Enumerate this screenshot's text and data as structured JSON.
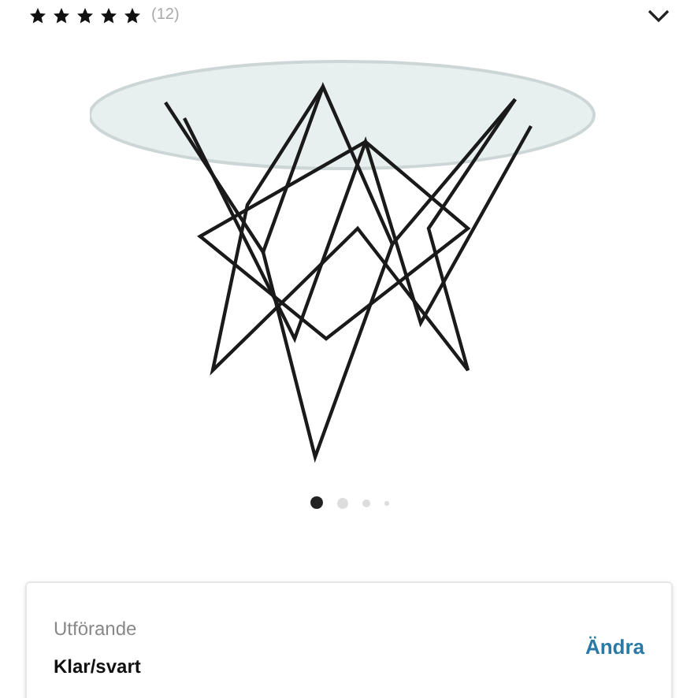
{
  "rating": {
    "stars": 5,
    "count": "(12)"
  },
  "gallery": {
    "dots": [
      {
        "selected": true
      },
      {
        "selected": false
      },
      {
        "selected": false
      },
      {
        "selected": false
      }
    ]
  },
  "variant": {
    "label": "Utförande",
    "value": "Klar/svart",
    "action": "Ändra"
  }
}
